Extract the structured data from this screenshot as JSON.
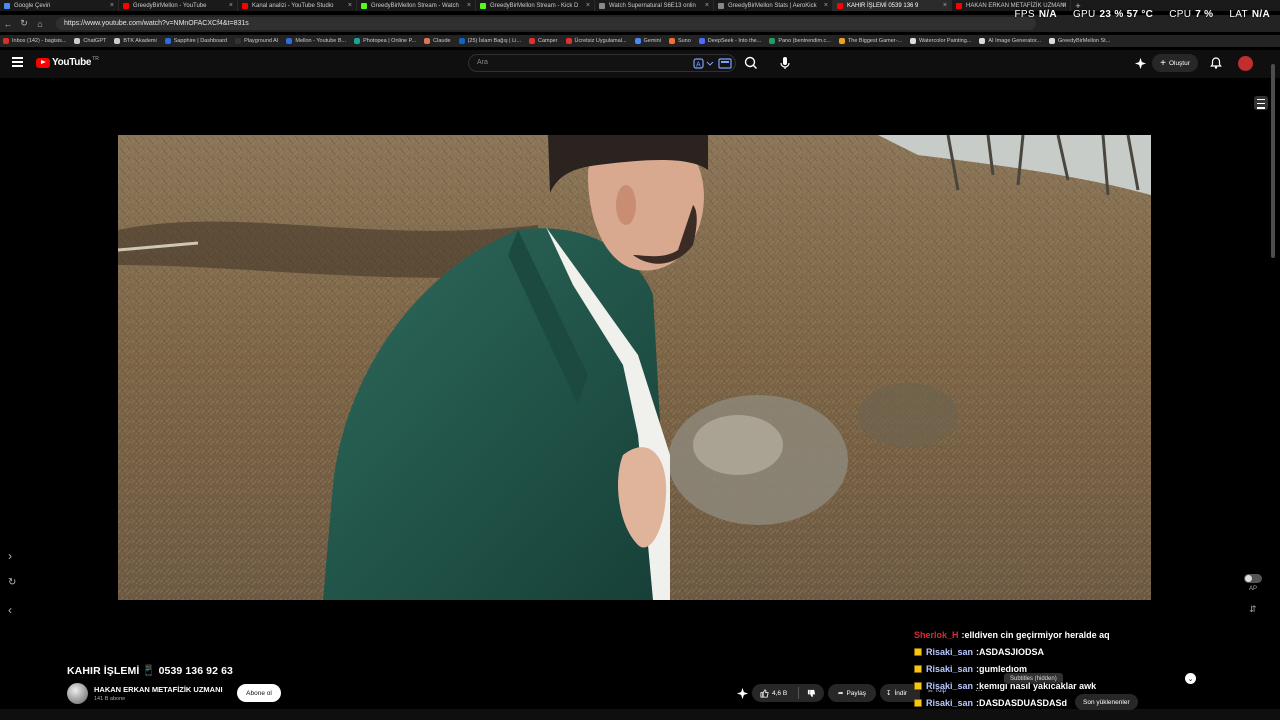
{
  "browser": {
    "tabs": [
      {
        "title": "Google Çeviri",
        "color": "#4a8af4"
      },
      {
        "title": "GreedyBirMellon - YouTube",
        "color": "#ff0000"
      },
      {
        "title": "Kanal analizi - YouTube Studio",
        "color": "#ff0000"
      },
      {
        "title": "GreedyBirMellon Stream - Watch",
        "color": "#53fc18"
      },
      {
        "title": "GreedyBirMellon Stream - Kick D",
        "color": "#53fc18"
      },
      {
        "title": "Watch Supernatural S6E13 onlin",
        "color": "#888888"
      },
      {
        "title": "GreedyBirMellon Stats | AeroKick",
        "color": "#888888"
      },
      {
        "title": "KAHIR İŞLEMİ  0539 136 9",
        "color": "#ff0000",
        "active": true
      },
      {
        "title": "HAKAN ERKAN METAFİZİK UZMANI",
        "color": "#ff0000"
      }
    ],
    "url": "https://www.youtube.com/watch?v=NMnOFACXCf4&t=831s",
    "bookmarks": [
      {
        "label": "Inbox (142) - bagisis...",
        "color": "#d93025"
      },
      {
        "label": "ChatGPT",
        "color": "#cccccc"
      },
      {
        "label": "BTK Akademi",
        "color": "#cccccc"
      },
      {
        "label": "Sapphire | Dashboard",
        "color": "#2d6cdf"
      },
      {
        "label": "Playground AI",
        "color": "#333333"
      },
      {
        "label": "Mellon - Youtube B...",
        "color": "#2d6cdf"
      },
      {
        "label": "Photopea | Online P...",
        "color": "#18a497"
      },
      {
        "label": "Claude",
        "color": "#d97757"
      },
      {
        "label": "(25) İslam Bağış | Li...",
        "color": "#0a66c2"
      },
      {
        "label": "Camper",
        "color": "#e03030"
      },
      {
        "label": "Ücretsiz Uygulamal...",
        "color": "#e03030"
      },
      {
        "label": "Gemini",
        "color": "#4a8af4"
      },
      {
        "label": "Suno",
        "color": "#f07030"
      },
      {
        "label": "DeepSeek - Into the...",
        "color": "#4d6bfe"
      },
      {
        "label": "Pano (bentrendim.c...",
        "color": "#20a060"
      },
      {
        "label": "The Biggest Gamer-...",
        "color": "#f0a020"
      },
      {
        "label": "Watercolor Painting...",
        "color": "#dddddd"
      },
      {
        "label": "AI Image Generator...",
        "color": "#dddddd"
      },
      {
        "label": "GreedyBirMellon St...",
        "color": "#dddddd"
      }
    ]
  },
  "stats_overlay": {
    "fps_label": "FPS",
    "fps_value": "N/A",
    "gpu_label": "GPU",
    "gpu_value": "23 % 57 °C",
    "cpu_label": "CPU",
    "cpu_value": "7 %",
    "lat_label": "LAT",
    "lat_value": "N/A"
  },
  "youtube": {
    "logo_text": "YouTube",
    "country": "TR",
    "search_placeholder": "Ara",
    "create_label": "Oluştur"
  },
  "video": {
    "title": "KAHIR İŞLEMİ 📱 0539 136 92 63",
    "channel_name": "HAKAN ERKAN  METAFİZİK UZMANI",
    "subscribers": "141 B abone",
    "subscribe_label": "Abone ol",
    "likes": "4,6 B",
    "share_label": "Paylaş",
    "download_label": "İndir",
    "clip_label": "Klip"
  },
  "side": {
    "ap_label": "AP"
  },
  "chat": {
    "messages": [
      {
        "user": "Sherlok_H",
        "user_color": "#d8283a",
        "badge": false,
        "text": "elldiven cin geçirmiyor heralde aq"
      },
      {
        "user": "Risaki_san",
        "user_color": "#b8c8ff",
        "badge": true,
        "text": "ASDASJIODSA"
      },
      {
        "user": "Risaki_san",
        "user_color": "#b8c8ff",
        "badge": true,
        "text": "gumledıom"
      },
      {
        "user": "Risaki_san",
        "user_color": "#b8c8ff",
        "badge": true,
        "text": "kemıgı nasıl yakıcaklar awk"
      },
      {
        "user": "Risaki_san",
        "user_color": "#b8c8ff",
        "badge": true,
        "text": "DASDASDUASDASd"
      }
    ],
    "subtitles_hidden_label": "Subtitles (hidden)",
    "recent_label": "Son yüklenenler"
  }
}
